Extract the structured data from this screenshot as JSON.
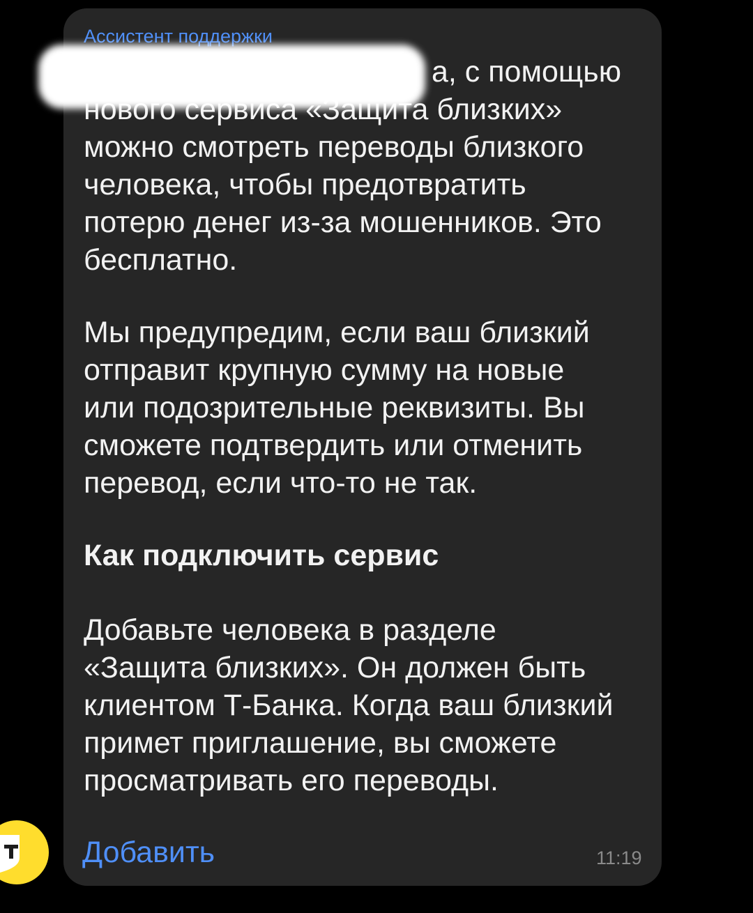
{
  "message": {
    "sender": "Ассистент поддержки",
    "paragraph1": [
      "а, с помощью",
      "нового сервиса «Защита близких»",
      "можно смотреть переводы близкого",
      "человека, чтобы предотвратить",
      "потерю денег из-за мошенников. Это",
      "бесплатно."
    ],
    "paragraph2": [
      "Мы предупредим, если ваш близкий",
      "отправит крупную сумму на новые",
      "или подозрительные реквизиты. Вы",
      "сможете подтвердить или отменить",
      "перевод, если что-то не так."
    ],
    "heading": "Как подключить сервис",
    "paragraph3": [
      "Добавьте человека в разделе",
      "«Защита близких». Он должен быть",
      "клиентом Т-Банка. Когда ваш близкий",
      "примет приглашение, вы сможете",
      "просматривать его переводы."
    ],
    "action_label": "Добавить",
    "time": "11:19"
  },
  "avatar": {
    "icon": "tbank-shield-logo",
    "letter": "T",
    "color": "#ffdd2d"
  },
  "colors": {
    "background": "#000000",
    "bubble": "#262626",
    "accent": "#4f8ff7",
    "text": "#f2f2f2",
    "timestamp": "#8a8a8a"
  }
}
